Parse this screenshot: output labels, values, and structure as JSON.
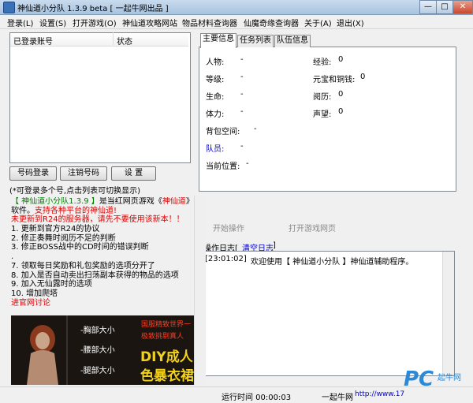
{
  "window": {
    "title": "神仙道小分队 1.3.9 beta [ 一起牛网出品 ]",
    "minimize": "—",
    "maximize": "□",
    "close": "✕"
  },
  "menu": [
    "登录(L)",
    "设置(S)",
    "打开游戏(O)",
    "神仙道攻略网站",
    "物品材料查询器",
    "仙魔奇缘查询器",
    "关于(A)",
    "退出(X)"
  ],
  "accounts": {
    "col_account": "已登录账号",
    "col_status": "状态"
  },
  "buttons": {
    "login": "号码登录",
    "logout": "注销号码",
    "settings": "设  置",
    "start_op": "开始操作",
    "open_game": "打开游戏网页",
    "clear_log": "清空日志"
  },
  "hint": "(*可登录多个号,点击列表可切换显示)",
  "tabs": [
    "主要信息",
    "任务列表",
    "队伍信息"
  ],
  "info": {
    "character": {
      "label": "人物:",
      "value": "-"
    },
    "level": {
      "label": "等级:",
      "value": "-"
    },
    "life": {
      "label": "生命:",
      "value": "-"
    },
    "stamina": {
      "label": "体力:",
      "value": "-"
    },
    "bag": {
      "label": "背包空间:",
      "value": "-"
    },
    "team": {
      "label": "队员:",
      "value": "-"
    },
    "location": {
      "label": "当前位置:",
      "value": "-"
    },
    "exp": {
      "label": "经验:",
      "value": "0"
    },
    "yuanbao": {
      "label": "元宝和铜钱:",
      "value": "0"
    },
    "history": {
      "label": "阅历:",
      "value": "0"
    },
    "fame": {
      "label": "声望:",
      "value": "0"
    }
  },
  "news": {
    "l1a": "【 神仙道小分队1.3.9 】",
    "l1b": "是当红网页游戏《",
    "l1c": "神仙道",
    "l1d": "》的",
    "l2a": "软件。",
    "l2b": "支持各种平台的神仙道!",
    "l3": "未更新到R24的服务器，请先不要使用该新本！！",
    "items": [
      "1. 更新到官方R24的协议",
      "2. 修正奏舞时阅历不足的判断",
      "3. 修正BOSS战中的CD时间的错误判断",
      ".",
      "7. 领取每日奖励和礼包奖励的选项分开了",
      "8. 加入是否自动卖出扫荡副本获得的物品的选项",
      "9. 加入无仙露时的选项",
      "10. 增加爬塔"
    ],
    "forum": "进官网讨论"
  },
  "banner": {
    "opt1": "-胸部大小",
    "opt2": "-腰部大小",
    "opt3": "-腿部大小",
    "tag1": "国服精致世界一",
    "tag2": "极致挑剔真人",
    "big1": "DIY成人",
    "big2": "色暴衣裙"
  },
  "log": {
    "label": "操作日志[",
    "entry_time": "[23:01:02]",
    "entry_text": "欢迎使用【 神仙道小分队 】神仙道辅助程序。"
  },
  "status": {
    "runtime": "运行时间 00:00:03",
    "brand": "一起牛网",
    "url": "http://www.17",
    "watermark1": "PC",
    "watermark2": "起牛网"
  },
  "colors": {
    "accent_red": "#e00000",
    "accent_green": "#008000",
    "link_blue": "#0000d0",
    "banner_yellow": "#f2d21b"
  }
}
